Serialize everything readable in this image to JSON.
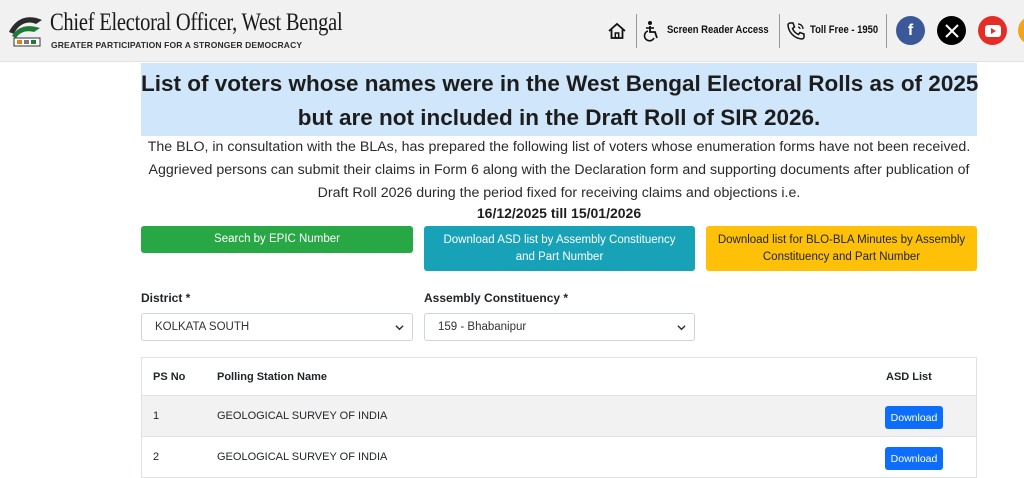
{
  "header": {
    "title": "Chief Electoral Officer, West Bengal",
    "tagline": "GREATER PARTICIPATION FOR A STRONGER DEMOCRACY",
    "nav": {
      "home_icon": "home-icon",
      "accessibility_icon": "accessibility-icon",
      "screen_reader_label": "Screen Reader Access",
      "phone_icon": "phone-icon",
      "toll_free_label": "Toll Free - 1950"
    },
    "social": [
      {
        "name": "facebook-icon",
        "glyph": "f",
        "color": "#3b5998"
      },
      {
        "name": "x-icon",
        "glyph": "𝕏",
        "color": "#000000"
      },
      {
        "name": "youtube-icon",
        "glyph": "▶",
        "color": "#e52d27"
      }
    ]
  },
  "banner": {
    "line1": "List of voters whose names were in the West Bengal Electoral Rolls as of 2025",
    "line2": "but are not included in the Draft Roll of SIR 2026."
  },
  "intro": {
    "line1": "The BLO, in consultation with the BLAs, has prepared the following list of voters whose enumeration forms have not been received.",
    "line2": "Aggrieved persons can submit their claims in Form 6 along with the Declaration form and supporting documents after publication of",
    "line3": "Draft Roll 2026 during the period fixed for receiving claims and objections i.e.",
    "dates": "16/12/2025 till 15/01/2026"
  },
  "actions": {
    "search_epic": "Search by EPIC Number",
    "download_asd": "Download ASD list by Assembly Constituency and Part Number",
    "download_blo": "Download list for BLO-BLA Minutes by Assembly Constituency and Part Number"
  },
  "filters": {
    "district_label": "District *",
    "district_value": "KOLKATA SOUTH",
    "ac_label": "Assembly Constituency *",
    "ac_value": "159 - Bhabanipur"
  },
  "table": {
    "headers": [
      "PS No",
      "Polling Station Name",
      "ASD List"
    ],
    "rows": [
      {
        "ps_no": "1",
        "name": "GEOLOGICAL SURVEY OF INDIA",
        "action": "Download"
      },
      {
        "ps_no": "2",
        "name": "GEOLOGICAL SURVEY OF INDIA",
        "action": "Download"
      }
    ]
  },
  "colors": {
    "banner_bg": "#cfe6fb",
    "green": "#28a745",
    "teal": "#17a2b8",
    "yellow": "#ffc107",
    "primary": "#0d6efd"
  }
}
